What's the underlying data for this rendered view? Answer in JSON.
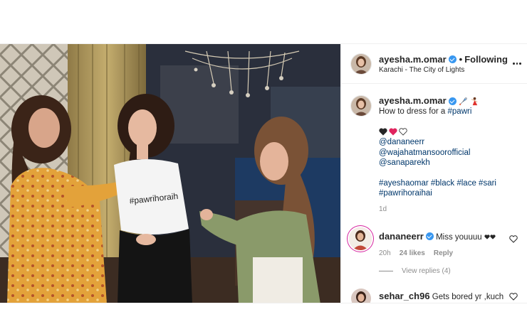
{
  "post": {
    "author": {
      "username": "ayesha.m.omar",
      "verified": true
    },
    "follow_dot": "•",
    "follow_label": "Following",
    "location": "Karachi - The City of Lights",
    "media": {
      "tshirt_text": "#pawrihoraih"
    },
    "caption": {
      "username": "ayesha.m.omar",
      "line1_text": "How to dress for a ",
      "line1_tag": "#pawri",
      "hearts": [
        "black-heart",
        "red-heart",
        "white-heart"
      ],
      "mentions": [
        "@dananeerr",
        "@wajahatmansoorofficial",
        "@sanaparekh"
      ],
      "hashtags_line1": [
        "#ayeshaomar",
        "#black",
        "#lace",
        "#sari"
      ],
      "hashtags_line2": [
        "#pawrihoraihai"
      ],
      "time": "1d"
    },
    "comments": [
      {
        "username": "dananeerr",
        "verified": true,
        "text": "Miss youuuu",
        "trailing_icons": [
          "black-heart",
          "black-heart"
        ],
        "time": "20h",
        "likes": "24 likes",
        "reply_label": "Reply",
        "view_replies": "View replies (4)"
      },
      {
        "username": "sehar_ch96",
        "verified": false,
        "text": "Gets bored yr ,kuch"
      }
    ]
  },
  "colors": {
    "verified": "#3897f0",
    "link": "#00376b",
    "muted": "#8e8e8e",
    "text": "#262626"
  }
}
